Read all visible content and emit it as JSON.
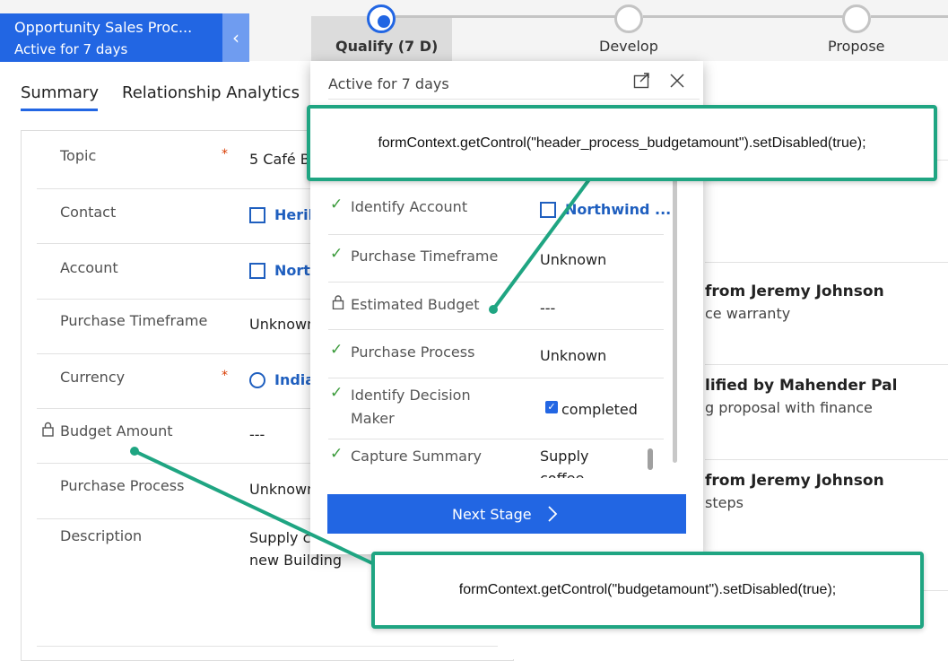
{
  "process": {
    "name": "Opportunity Sales Proc...",
    "active_for": "Active for 7 days",
    "collapse_glyph": "‹",
    "stages": [
      {
        "label": "Qualify  (7 D)",
        "state": "active"
      },
      {
        "label": "Develop",
        "state": "inactive"
      },
      {
        "label": "Propose",
        "state": "inactive"
      }
    ]
  },
  "tabs": [
    {
      "label": "Summary",
      "selected": true
    },
    {
      "label": "Relationship Analytics",
      "selected": false
    }
  ],
  "form": {
    "fields": [
      {
        "label": "Topic",
        "required": true,
        "value": "5 Café B"
      },
      {
        "label": "Contact",
        "required": false,
        "value": "Herib",
        "lookup_icon": "contact-icon"
      },
      {
        "label": "Account",
        "required": false,
        "value": "Nort",
        "lookup_icon": "account-icon"
      },
      {
        "label": "Purchase Timeframe",
        "required": false,
        "value": "Unknown"
      },
      {
        "label": "Currency",
        "required": true,
        "value": "India",
        "lookup_icon": "currency-icon"
      },
      {
        "label": "Budget Amount",
        "required": false,
        "value": "---",
        "locked": true
      },
      {
        "label": "Purchase Process",
        "required": false,
        "value": "Unknown"
      },
      {
        "label": "Description",
        "required": false,
        "value_line1": "Supply c",
        "value_line2": "new Building"
      }
    ],
    "required_mark": "*"
  },
  "timeline": [
    {
      "title": "from Jeremy Johnson",
      "subtitle": "ce warranty"
    },
    {
      "title": "lified by Mahender Pal",
      "subtitle": "g proposal with finance"
    },
    {
      "title": "from Jeremy Johnson",
      "subtitle": "steps"
    }
  ],
  "flyout": {
    "header": "Active for 7 days",
    "steps": [
      {
        "label": "Identify Account",
        "value": "Northwind ...",
        "status": "check",
        "is_link": true
      },
      {
        "label": "Purchase Timeframe",
        "value": "Unknown",
        "status": "check"
      },
      {
        "label": "Estimated Budget",
        "value": "---",
        "status": "lock"
      },
      {
        "label": "Purchase Process",
        "value": "Unknown",
        "status": "check"
      },
      {
        "label_line1": "Identify Decision",
        "label_line2": "Maker",
        "value": "completed",
        "status": "check",
        "checkbox_checked": true
      },
      {
        "label": "Capture Summary",
        "value_line1": "Supply",
        "value_line2": "coffee",
        "status": "check"
      }
    ],
    "next_stage_label": "Next Stage"
  },
  "callouts": {
    "top": "formContext.getControl(\"header_process_budgetamount\").setDisabled(true);",
    "bottom": "formContext.getControl(\"budgetamount\").setDisabled(true);",
    "color": "#1fa582"
  },
  "colors": {
    "accent": "#2266e3",
    "link": "#1f5fbf",
    "check": "#3a9a3a",
    "required": "#d83b01"
  }
}
